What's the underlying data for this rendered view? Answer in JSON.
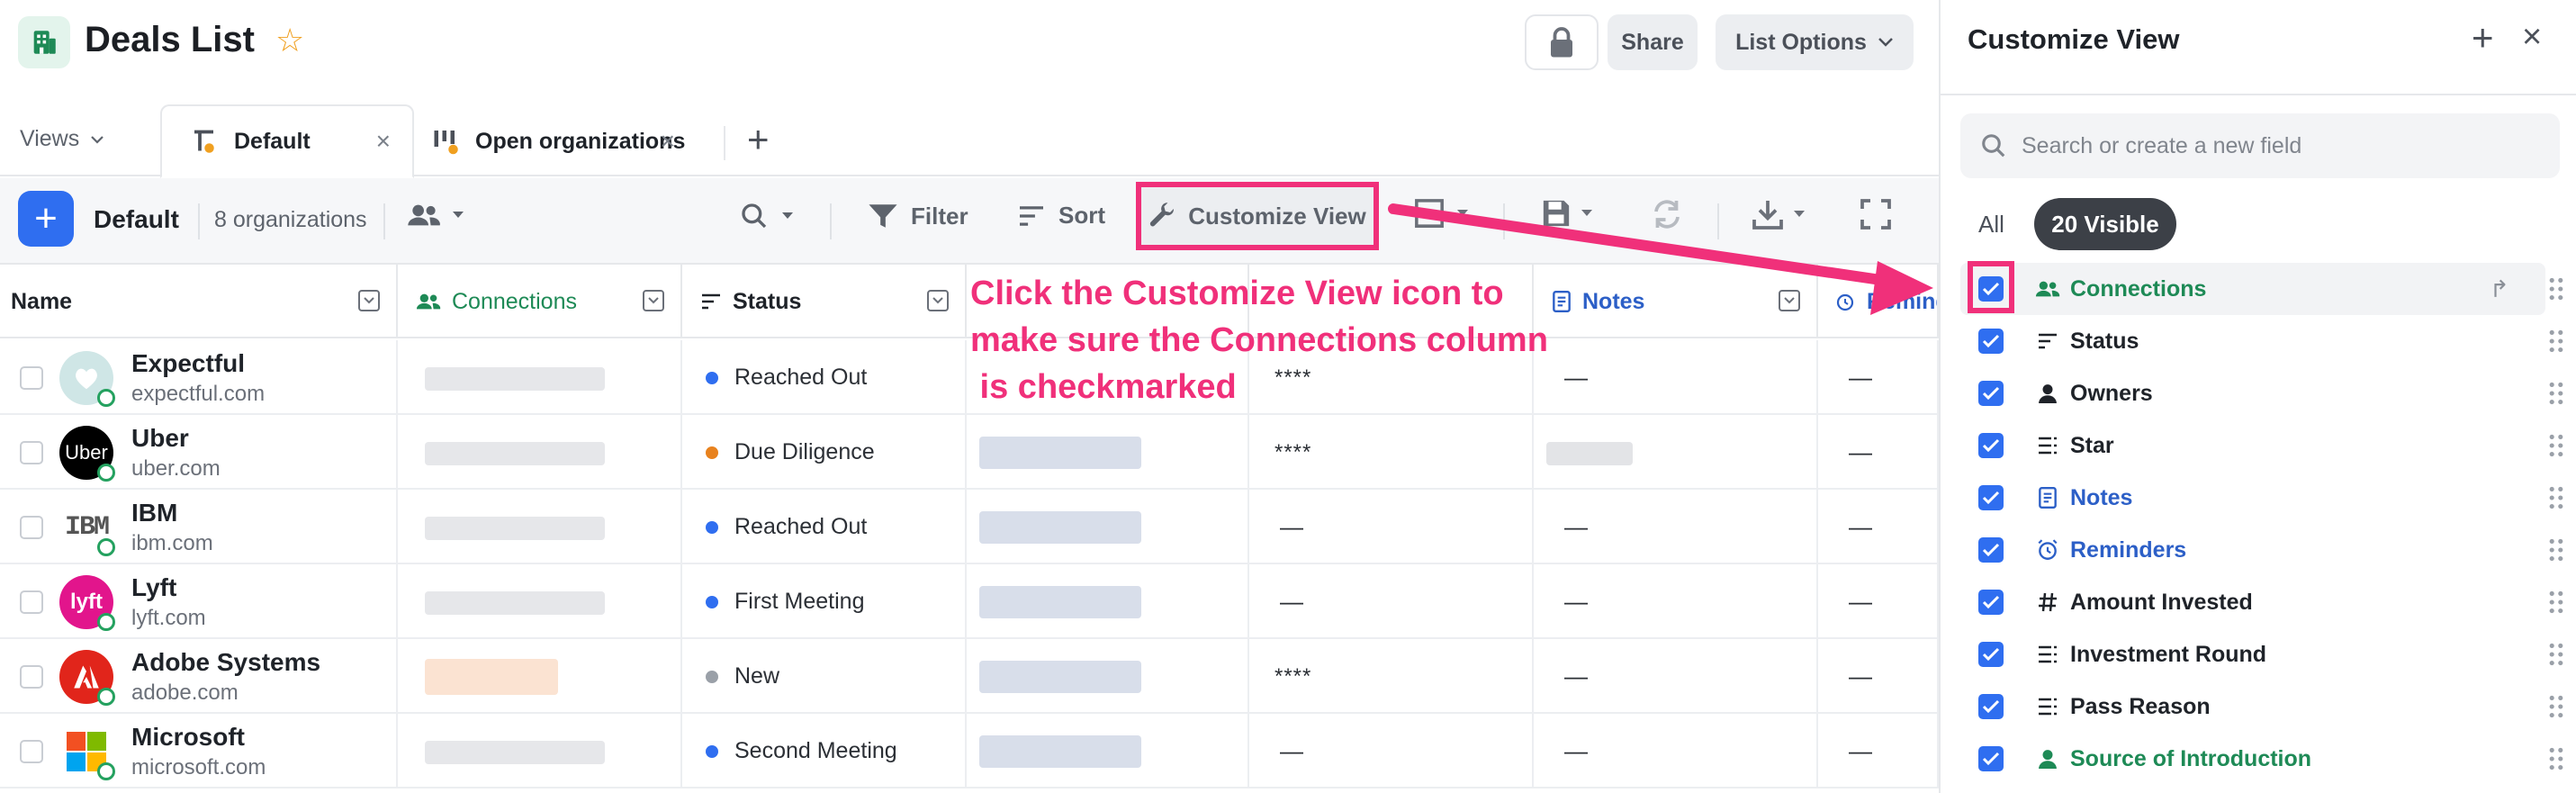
{
  "header": {
    "title": "Deals List",
    "share_label": "Share",
    "list_options_label": "List Options"
  },
  "tabs": {
    "views_label": "Views",
    "items": [
      {
        "label": "Default",
        "active": true
      },
      {
        "label": "Open organizations",
        "active": false
      }
    ]
  },
  "toolbar": {
    "view_name": "Default",
    "org_count": "8 organizations",
    "filter_label": "Filter",
    "sort_label": "Sort",
    "customize_label": "Customize View"
  },
  "table": {
    "columns": [
      "Name",
      "Connections",
      "Status",
      "",
      "",
      "Notes",
      "Reminders"
    ],
    "rows": [
      {
        "name": "Expectful",
        "domain": "expectful.com",
        "status": "Reached Out",
        "status_color": "#2f6ef0",
        "col5": "****",
        "notes": "—",
        "reminders": "—"
      },
      {
        "name": "Uber",
        "domain": "uber.com",
        "status": "Due Diligence",
        "status_color": "#e8821e",
        "col5": "****",
        "notes": "",
        "reminders": "—"
      },
      {
        "name": "IBM",
        "domain": "ibm.com",
        "status": "Reached Out",
        "status_color": "#2f6ef0",
        "col5": "—",
        "notes": "—",
        "reminders": "—"
      },
      {
        "name": "Lyft",
        "domain": "lyft.com",
        "status": "First Meeting",
        "status_color": "#2f6ef0",
        "col5": "—",
        "notes": "—",
        "reminders": "—"
      },
      {
        "name": "Adobe Systems",
        "domain": "adobe.com",
        "status": "New",
        "status_color": "#9aa0a8",
        "col5": "****",
        "notes": "—",
        "reminders": "—"
      },
      {
        "name": "Microsoft",
        "domain": "microsoft.com",
        "status": "Second Meeting",
        "status_color": "#2f6ef0",
        "col5": "—",
        "notes": "—",
        "reminders": "—"
      }
    ]
  },
  "annotation": {
    "text": "Click the Customize View icon to\nmake sure the Connections column\n is checkmarked",
    "color": "#f0307a"
  },
  "panel": {
    "title": "Customize View",
    "search_placeholder": "Search or create a new field",
    "filter_all": "All",
    "filter_visible": "20 Visible",
    "fields": [
      {
        "label": "Connections",
        "icon": "people-icon",
        "color": "green"
      },
      {
        "label": "Status",
        "icon": "status-list-icon",
        "color": "default"
      },
      {
        "label": "Owners",
        "icon": "person-icon",
        "color": "default"
      },
      {
        "label": "Star",
        "icon": "select-list-icon",
        "color": "default"
      },
      {
        "label": "Notes",
        "icon": "note-icon",
        "color": "blue"
      },
      {
        "label": "Reminders",
        "icon": "alarm-clock-icon",
        "color": "blue"
      },
      {
        "label": "Amount Invested",
        "icon": "hash-icon",
        "color": "default"
      },
      {
        "label": "Investment Round",
        "icon": "select-list-icon",
        "color": "default"
      },
      {
        "label": "Pass Reason",
        "icon": "select-list-icon",
        "color": "default"
      },
      {
        "label": "Source of Introduction",
        "icon": "person-icon",
        "color": "green"
      }
    ]
  },
  "colors": {
    "accent": "#2f6ef0",
    "highlight": "#f0307a",
    "connections_green": "#1e8a56"
  }
}
